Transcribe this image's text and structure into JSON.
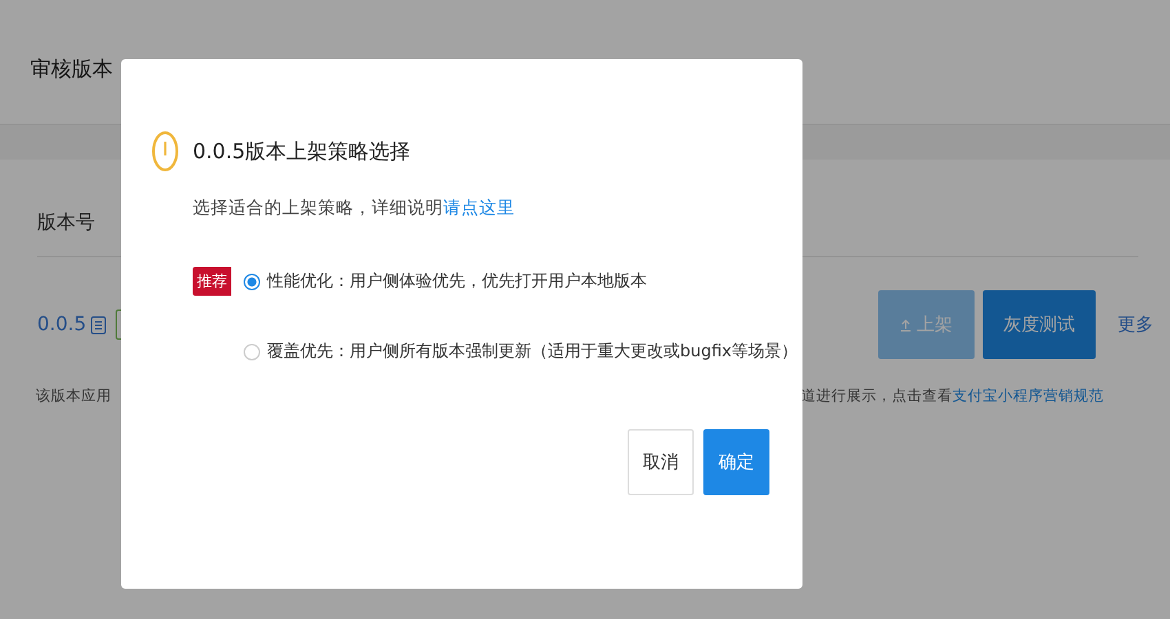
{
  "page": {
    "title": "审核版本",
    "column_header": "版本号",
    "version": "0.0.5",
    "note_left": "该版本应用",
    "note_right": "道进行展示，点击查看",
    "note_link": "支付宝小程序营销规范",
    "actions": [
      {
        "label": "上架",
        "kind": "button",
        "disabled": true
      },
      {
        "label": "灰度测试",
        "kind": "button",
        "disabled": false
      },
      {
        "label": "更多",
        "kind": "link",
        "disabled": false
      }
    ]
  },
  "dialog": {
    "title": "0.0.5版本上架策略选择",
    "description": "选择适合的上架策略，详细说明",
    "link": "请点这里",
    "options": [
      {
        "badge": "推荐",
        "label": "性能优化：用户侧体验优先，优先打开用户本地版本",
        "selected": true
      },
      {
        "label": "覆盖优先：用户侧所有版本强制更新（适用于重大更改或bugfix等场景）",
        "selected": false
      }
    ],
    "buttons": [
      {
        "label": "取消",
        "kind": "default"
      },
      {
        "label": "确定",
        "kind": "primary"
      }
    ]
  }
}
